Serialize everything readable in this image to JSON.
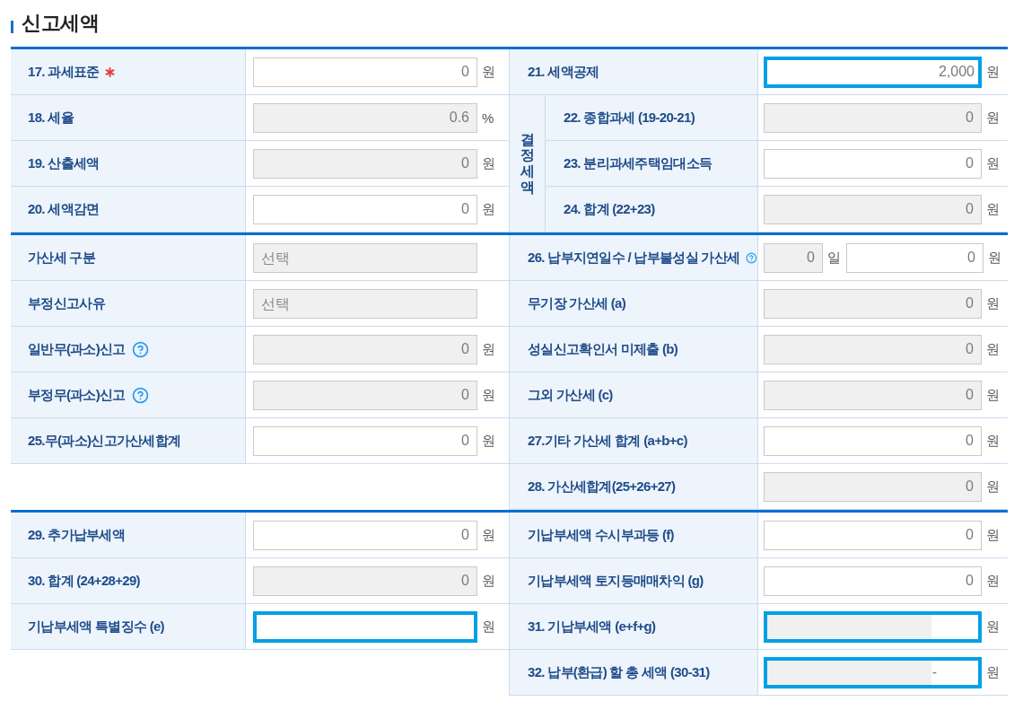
{
  "title": "신고세액",
  "sections": [
    {
      "left": [
        {
          "kind": "field",
          "label": "17. 과세표준",
          "required": true,
          "help": false,
          "fields": [
            {
              "value": "0",
              "unit": "원",
              "disabled": false,
              "highlighted": false
            }
          ]
        },
        {
          "kind": "field",
          "label": "18. 세율",
          "required": false,
          "help": false,
          "fields": [
            {
              "value": "0.6",
              "unit": "%",
              "disabled": true,
              "highlighted": false
            }
          ]
        },
        {
          "kind": "field",
          "label": "19. 산출세액",
          "required": false,
          "help": false,
          "fields": [
            {
              "value": "0",
              "unit": "원",
              "disabled": true,
              "highlighted": false
            }
          ]
        },
        {
          "kind": "field",
          "label": "20. 세액감면",
          "required": false,
          "help": false,
          "fields": [
            {
              "value": "0",
              "unit": "원",
              "disabled": false,
              "highlighted": false
            }
          ]
        }
      ],
      "right": [
        {
          "kind": "field",
          "label": "21. 세액공제",
          "required": false,
          "help": false,
          "fields": [
            {
              "value": "2,000",
              "unit": "원",
              "disabled": false,
              "highlighted": true
            }
          ]
        },
        {
          "kind": "group",
          "label": "결정세액",
          "rows": [
            {
              "kind": "field",
              "label": "22. 종합과세 (19-20-21)",
              "required": false,
              "help": false,
              "fields": [
                {
                  "value": "0",
                  "unit": "원",
                  "disabled": true,
                  "highlighted": false
                }
              ]
            },
            {
              "kind": "field",
              "label": "23. 분리과세주택임대소득",
              "required": false,
              "help": false,
              "fields": [
                {
                  "value": "0",
                  "unit": "원",
                  "disabled": false,
                  "highlighted": false
                }
              ]
            },
            {
              "kind": "field",
              "label": "24. 합계 (22+23)",
              "required": false,
              "help": false,
              "fields": [
                {
                  "value": "0",
                  "unit": "원",
                  "disabled": true,
                  "highlighted": false
                }
              ]
            }
          ]
        }
      ]
    },
    {
      "left": [
        {
          "kind": "select",
          "label": "가산세 구분",
          "required": false,
          "help": false,
          "value": "선택",
          "disabled": true
        },
        {
          "kind": "select",
          "label": "부정신고사유",
          "required": false,
          "help": false,
          "value": "선택",
          "disabled": true
        },
        {
          "kind": "field",
          "label": "일반무(과소)신고",
          "required": false,
          "help": true,
          "fields": [
            {
              "value": "0",
              "unit": "원",
              "disabled": true,
              "highlighted": false
            }
          ]
        },
        {
          "kind": "field",
          "label": "부정무(과소)신고",
          "required": false,
          "help": true,
          "fields": [
            {
              "value": "0",
              "unit": "원",
              "disabled": true,
              "highlighted": false
            }
          ]
        },
        {
          "kind": "field",
          "label": "25.무(과소)신고가산세합계",
          "required": false,
          "help": false,
          "fields": [
            {
              "value": "0",
              "unit": "원",
              "disabled": false,
              "highlighted": false
            }
          ]
        }
      ],
      "right": [
        {
          "kind": "field",
          "label": "26. 납부지연일수 / 납부불성실 가산세",
          "required": false,
          "help": true,
          "fields": [
            {
              "value": "0",
              "unit": "일",
              "disabled": true,
              "highlighted": false
            },
            {
              "value": "0",
              "unit": "원",
              "disabled": false,
              "highlighted": false
            }
          ]
        },
        {
          "kind": "field",
          "label": "무기장 가산세 (a)",
          "required": false,
          "help": false,
          "fields": [
            {
              "value": "0",
              "unit": "원",
              "disabled": true,
              "highlighted": false
            }
          ]
        },
        {
          "kind": "field",
          "label": "성실신고확인서 미제출 (b)",
          "required": false,
          "help": false,
          "fields": [
            {
              "value": "0",
              "unit": "원",
              "disabled": true,
              "highlighted": false
            }
          ]
        },
        {
          "kind": "field",
          "label": "그외 가산세 (c)",
          "required": false,
          "help": false,
          "fields": [
            {
              "value": "0",
              "unit": "원",
              "disabled": true,
              "highlighted": false
            }
          ]
        },
        {
          "kind": "field",
          "label": "27.기타 가산세 합계 (a+b+c)",
          "required": false,
          "help": false,
          "fields": [
            {
              "value": "0",
              "unit": "원",
              "disabled": false,
              "highlighted": false
            }
          ]
        },
        {
          "kind": "field",
          "label": "28. 가산세합계(25+26+27)",
          "required": false,
          "help": false,
          "fields": [
            {
              "value": "0",
              "unit": "원",
              "disabled": true,
              "highlighted": false
            }
          ]
        }
      ]
    },
    {
      "left": [
        {
          "kind": "field",
          "label": "29. 추가납부세액",
          "required": false,
          "help": false,
          "fields": [
            {
              "value": "0",
              "unit": "원",
              "disabled": false,
              "highlighted": false
            }
          ]
        },
        {
          "kind": "field",
          "label": "30. 합계 (24+28+29)",
          "required": false,
          "help": false,
          "fields": [
            {
              "value": "0",
              "unit": "원",
              "disabled": true,
              "highlighted": false
            }
          ]
        },
        {
          "kind": "field",
          "label": "기납부세액 특별징수 (e)",
          "required": false,
          "help": false,
          "fields": [
            {
              "unit": "원",
              "disabled": false,
              "highlighted": true
            }
          ]
        }
      ],
      "right": [
        {
          "kind": "field",
          "label": "기납부세액 수시부과등 (f)",
          "required": false,
          "help": false,
          "fields": [
            {
              "value": "0",
              "unit": "원",
              "disabled": false,
              "highlighted": false
            }
          ]
        },
        {
          "kind": "field",
          "label": "기납부세액 토지등매매차익 (g)",
          "required": false,
          "help": false,
          "fields": [
            {
              "value": "0",
              "unit": "원",
              "disabled": false,
              "highlighted": false
            }
          ]
        },
        {
          "kind": "field",
          "label": "31. 기납부세액 (e+f+g)",
          "required": false,
          "help": false,
          "fields": [
            {
              "unit": "원",
              "disabled": true,
              "highlighted": true
            }
          ]
        },
        {
          "kind": "field",
          "label": "32. 납부(환급) 할 총 세액 (30-31)",
          "required": false,
          "help": false,
          "fields": [
            {
              "value": "-",
              "unit": "원",
              "disabled": true,
              "highlighted": true
            }
          ]
        }
      ]
    }
  ]
}
